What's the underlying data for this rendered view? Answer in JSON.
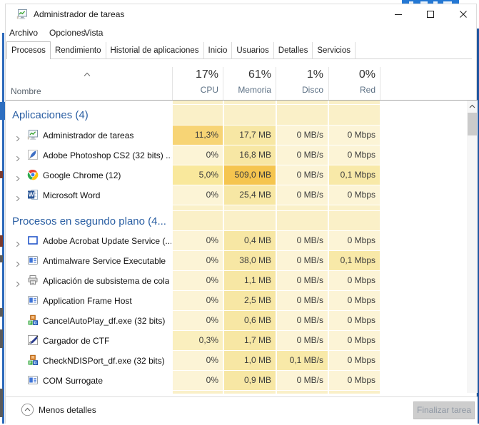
{
  "window": {
    "title": "Administrador de tareas"
  },
  "menu": {
    "items": [
      "Archivo",
      "Opciones",
      "Vista"
    ]
  },
  "tabs": {
    "items": [
      "Procesos",
      "Rendimiento",
      "Historial de aplicaciones",
      "Inicio",
      "Usuarios",
      "Detalles",
      "Servicios"
    ],
    "selected": "Procesos"
  },
  "table": {
    "name_header": "Nombre",
    "columns": [
      {
        "usage": "17%",
        "label": "CPU"
      },
      {
        "usage": "61%",
        "label": "Memoria"
      },
      {
        "usage": "1%",
        "label": "Disco"
      },
      {
        "usage": "0%",
        "label": "Red"
      }
    ],
    "rows": [
      {
        "type": "filler",
        "h": 6
      },
      {
        "type": "section",
        "label": "Aplicaciones (4)",
        "h": 29
      },
      {
        "type": "process",
        "name": "Administrador de tareas",
        "icon": "task-manager",
        "expander": true,
        "values": [
          "11,3%",
          "17,7 MB",
          "0 MB/s",
          "0 Mbps"
        ],
        "tones": [
          "cpu11",
          "mem",
          "zero",
          "zero"
        ]
      },
      {
        "type": "process",
        "name": "Adobe Photoshop CS2 (32 bits) ...",
        "icon": "photoshop",
        "expander": true,
        "values": [
          "0%",
          "16,8 MB",
          "0 MB/s",
          "0 Mbps"
        ],
        "tones": [
          "zero",
          "mem",
          "zero",
          "zero"
        ]
      },
      {
        "type": "process",
        "name": "Google Chrome (12)",
        "icon": "chrome",
        "expander": true,
        "values": [
          "5,0%",
          "509,0 MB",
          "0 MB/s",
          "0,1 Mbps"
        ],
        "tones": [
          "cpu5",
          "mem509",
          "zero",
          "low"
        ]
      },
      {
        "type": "process",
        "name": "Microsoft Word",
        "icon": "word",
        "expander": true,
        "values": [
          "0%",
          "25,4 MB",
          "0 MB/s",
          "0 Mbps"
        ],
        "tones": [
          "zero",
          "mem",
          "zero",
          "zero"
        ]
      },
      {
        "type": "filler",
        "h": 8
      },
      {
        "type": "section",
        "label": "Procesos en segundo plano (4...",
        "h": 28
      },
      {
        "type": "process",
        "name": "Adobe Acrobat Update Service (...",
        "icon": "acrobat-update",
        "expander": true,
        "values": [
          "0%",
          "0,4 MB",
          "0 MB/s",
          "0 Mbps"
        ],
        "tones": [
          "zero",
          "mem",
          "zero",
          "zero"
        ]
      },
      {
        "type": "process",
        "name": "Antimalware Service Executable",
        "icon": "app-window",
        "expander": true,
        "values": [
          "0%",
          "38,0 MB",
          "0 MB/s",
          "0,1 Mbps"
        ],
        "tones": [
          "zero",
          "mem",
          "zero",
          "low"
        ]
      },
      {
        "type": "process",
        "name": "Aplicación de subsistema de cola",
        "icon": "printer",
        "expander": true,
        "values": [
          "0%",
          "1,1 MB",
          "0 MB/s",
          "0 Mbps"
        ],
        "tones": [
          "zero",
          "mem",
          "zero",
          "zero"
        ]
      },
      {
        "type": "process",
        "name": "Application Frame Host",
        "icon": "app-window",
        "expander": false,
        "values": [
          "0%",
          "2,5 MB",
          "0 MB/s",
          "0 Mbps"
        ],
        "tones": [
          "zero",
          "mem",
          "zero",
          "zero"
        ]
      },
      {
        "type": "process",
        "name": "CancelAutoPlay_df.exe (32 bits)",
        "icon": "blocks",
        "expander": false,
        "values": [
          "0%",
          "0,6 MB",
          "0 MB/s",
          "0 Mbps"
        ],
        "tones": [
          "zero",
          "mem",
          "zero",
          "zero"
        ]
      },
      {
        "type": "process",
        "name": "Cargador de CTF",
        "icon": "pen-document",
        "expander": false,
        "values": [
          "0,3%",
          "1,7 MB",
          "0 MB/s",
          "0 Mbps"
        ],
        "tones": [
          "cpu03",
          "mem",
          "zero",
          "zero"
        ]
      },
      {
        "type": "process",
        "name": "CheckNDISPort_df.exe (32 bits)",
        "icon": "blocks",
        "expander": false,
        "values": [
          "0%",
          "1,0 MB",
          "0,1 MB/s",
          "0 Mbps"
        ],
        "tones": [
          "zero",
          "mem",
          "low",
          "zero"
        ]
      },
      {
        "type": "process",
        "name": "COM Surrogate",
        "icon": "app-window",
        "expander": false,
        "values": [
          "0%",
          "0,9 MB",
          "0 MB/s",
          "0 Mbps"
        ],
        "tones": [
          "zero",
          "mem",
          "zero",
          "zero"
        ]
      },
      {
        "type": "filler",
        "h": 5
      }
    ]
  },
  "footer": {
    "less_details": "Menos detalles",
    "end_task": "Finalizar tarea"
  },
  "colors": {
    "sec": "#FAF0C8",
    "zero": "#FCF4D6",
    "mem": "#F7E7A4",
    "low": "#F8E9A8",
    "cpu03": "#FAEFBE",
    "cpu5": "#F9E89C",
    "cpu11": "#F7D475",
    "mem509": "#F5C54F",
    "accent": "#2b5fa3"
  }
}
